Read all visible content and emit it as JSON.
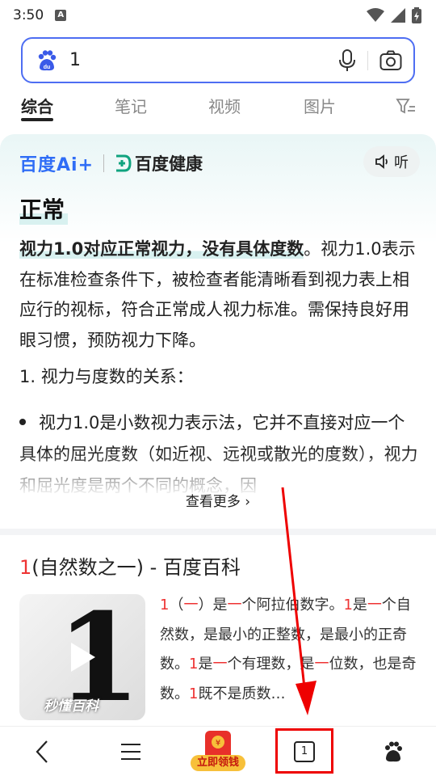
{
  "status_bar": {
    "time": "3:50",
    "note_icon_text": "A"
  },
  "search": {
    "query": "1"
  },
  "tabs": [
    {
      "label": "综合"
    },
    {
      "label": "笔记"
    },
    {
      "label": "视频"
    },
    {
      "label": "图片"
    }
  ],
  "ai_card": {
    "brand_ai": "百度Ai+",
    "brand_health": "百度健康",
    "listen_label": "听",
    "title": "正常",
    "para_bold": "视力1.0对应正常视力，没有具体度数",
    "para_rest": "。视力1.0表示在标准检查条件下，被检查者能清晰看到视力表上相应行的视标，符合正常成人视力标准。需保持良好用眼习惯，预防视力下降。",
    "heading": "1. 视力与度数的关系：",
    "bullet": "视力1.0是小数视力表示法，它并不直接对应一个具体的屈光度数（如近视、远视或散光的度数），视力和屈光度是两个不同的概念，因",
    "see_more": "查看更多"
  },
  "result": {
    "title_red": "1",
    "title_rest": "(自然数之一) - 百度百科",
    "thumb_digit": "1",
    "thumb_logo": "秒懂百科",
    "snippet": [
      {
        "text": "1",
        "red": true
      },
      {
        "text": "（",
        "red": false
      },
      {
        "text": "一",
        "red": true
      },
      {
        "text": "）是",
        "red": false
      },
      {
        "text": "一",
        "red": true
      },
      {
        "text": "个阿拉伯数字。",
        "red": false
      },
      {
        "text": "1",
        "red": true
      },
      {
        "text": "是",
        "red": false
      },
      {
        "text": "一",
        "red": true
      },
      {
        "text": "个自然数，是最小的正整数，是最小的正奇数。",
        "red": false
      },
      {
        "text": "1",
        "red": true
      },
      {
        "text": "是",
        "red": false
      },
      {
        "text": "一",
        "red": true
      },
      {
        "text": "个有理数，是",
        "red": false
      },
      {
        "text": "一",
        "red": true
      },
      {
        "text": "位数，也是奇数。",
        "red": false
      },
      {
        "text": "1",
        "red": true
      },
      {
        "text": "既不是质数…",
        "red": false
      }
    ]
  },
  "bottom_nav": {
    "redpack_label": "立即领钱",
    "tab_count": "1"
  },
  "colors": {
    "accent": "#4e6ef2",
    "highlight_red": "#e00",
    "keyword_red": "#e33"
  }
}
